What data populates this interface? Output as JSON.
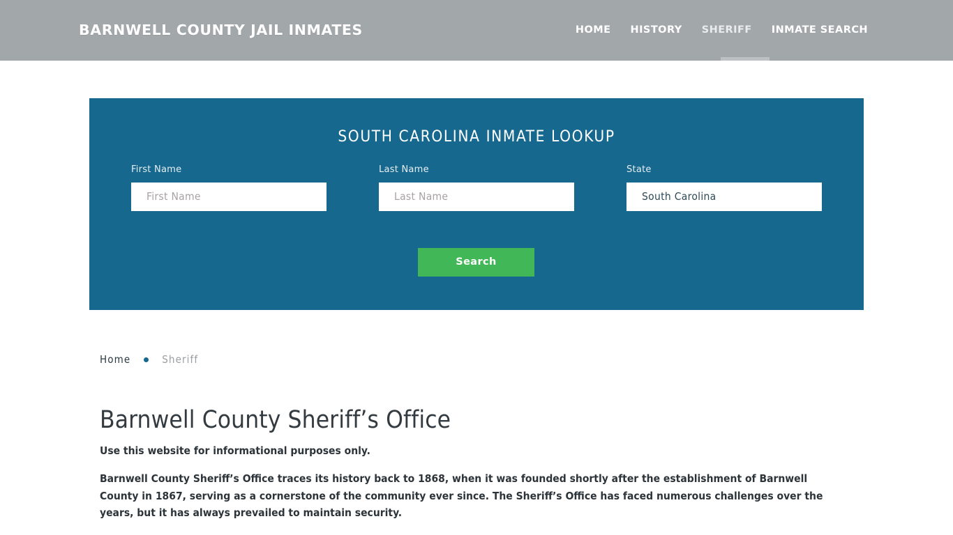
{
  "header": {
    "brand": "BARNWELL COUNTY JAIL INMATES",
    "nav": [
      {
        "label": "HOME",
        "active": false
      },
      {
        "label": "HISTORY",
        "active": false
      },
      {
        "label": "SHERIFF",
        "active": true
      },
      {
        "label": "INMATE SEARCH",
        "active": false
      }
    ],
    "background_color": "#a2a7aa",
    "active_underline_color": "#bcc0c2"
  },
  "lookup": {
    "title": "SOUTH CAROLINA INMATE LOOKUP",
    "panel_color": "#16688e",
    "fields": {
      "first_name": {
        "label": "First Name",
        "placeholder": "First Name",
        "value": ""
      },
      "last_name": {
        "label": "Last Name",
        "placeholder": "Last Name",
        "value": ""
      },
      "state": {
        "label": "State",
        "selected": "South Carolina",
        "options": [
          "South Carolina"
        ]
      }
    },
    "submit": {
      "label": "Search",
      "color": "#42b757"
    }
  },
  "breadcrumb": {
    "home": "Home",
    "current": "Sheriff",
    "separator_color": "#16688e"
  },
  "content": {
    "title": "Barnwell County Sheriff’s Office",
    "lede": "Use this website for informational purposes only.",
    "paragraph_1": "Barnwell County Sheriff’s Office traces its history back to 1868, when it was founded shortly after the establishment of Barnwell County in 1867, serving as a cornerstone of the community ever since. The Sheriff’s Office has faced numerous challenges over the years, but it has always prevailed to maintain security.",
    "paragraph_2_clipped": ""
  }
}
